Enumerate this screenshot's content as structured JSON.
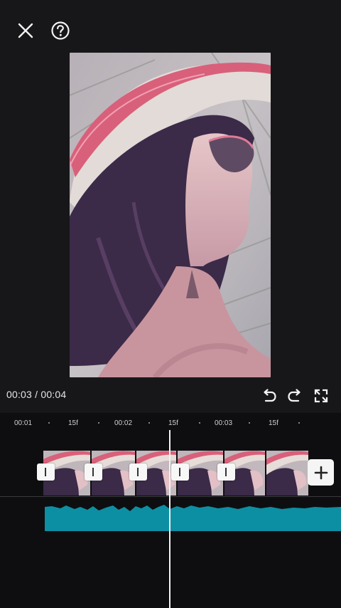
{
  "colors": {
    "background": "#171719",
    "timeline_bg": "#0e0e10",
    "audio_wave": "#0d8fa3",
    "playhead": "#f2f2f2"
  },
  "icons": {
    "close": "close-icon",
    "help": "help-icon",
    "undo": "undo-icon",
    "redo": "redo-icon",
    "fullscreen": "fullscreen-icon",
    "add": "plus-icon"
  },
  "player": {
    "current_time": "00:03",
    "separator": " / ",
    "total_time": "00:04"
  },
  "ruler": {
    "labels": [
      "00:01",
      "15f",
      "00:02",
      "15f",
      "00:03",
      "15f"
    ]
  }
}
